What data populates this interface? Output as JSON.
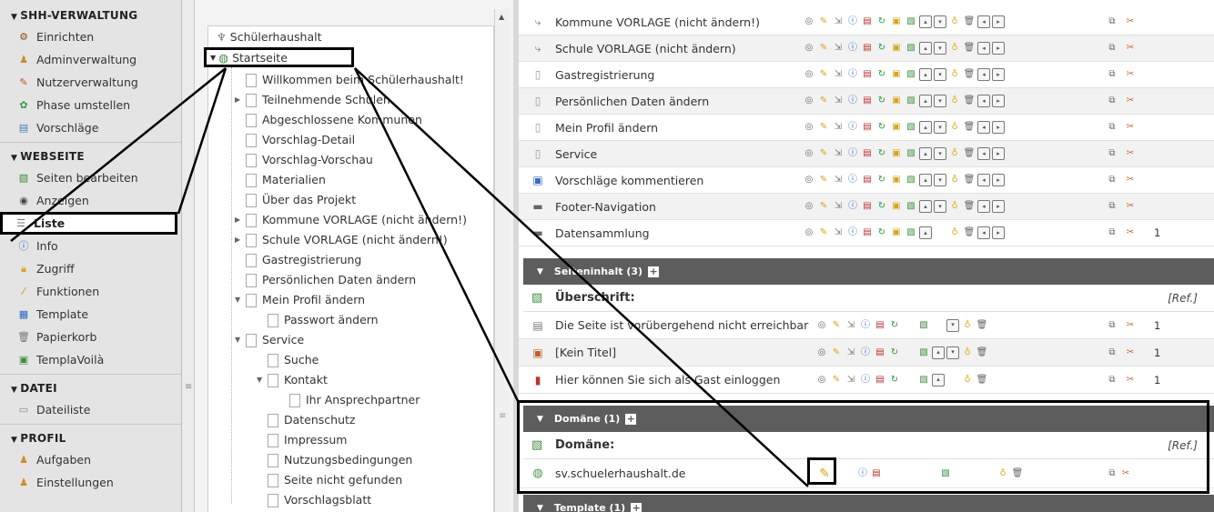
{
  "module_menu": {
    "sections": [
      {
        "title": "SHH-VERWALTUNG",
        "items": [
          {
            "label": "Einrichten",
            "icon": "gear-icon"
          },
          {
            "label": "Adminverwaltung",
            "icon": "users-icon"
          },
          {
            "label": "Nutzerverwaltung",
            "icon": "user-edit-icon"
          },
          {
            "label": "Phase umstellen",
            "icon": "phase-icon"
          },
          {
            "label": "Vorschläge",
            "icon": "document-icon"
          }
        ]
      },
      {
        "title": "WEBSEITE",
        "items": [
          {
            "label": "Seiten bearbeiten",
            "icon": "page-edit-icon"
          },
          {
            "label": "Anzeigen",
            "icon": "eye-icon"
          },
          {
            "label": "Liste",
            "icon": "list-icon",
            "active": true
          },
          {
            "label": "Info",
            "icon": "info-icon"
          },
          {
            "label": "Zugriff",
            "icon": "lock-icon"
          },
          {
            "label": "Funktionen",
            "icon": "wand-icon"
          },
          {
            "label": "Template",
            "icon": "template-icon"
          },
          {
            "label": "Papierkorb",
            "icon": "trash-icon"
          },
          {
            "label": "TemplaVoilà",
            "icon": "templavoila-icon"
          }
        ]
      },
      {
        "title": "DATEI",
        "items": [
          {
            "label": "Dateiliste",
            "icon": "folder-icon"
          }
        ]
      },
      {
        "title": "PROFIL",
        "items": [
          {
            "label": "Aufgaben",
            "icon": "tasks-icon"
          },
          {
            "label": "Einstellungen",
            "icon": "settings-user-icon"
          }
        ]
      }
    ]
  },
  "tree": {
    "root_label": "Schülerhaushalt",
    "start_label": "Startseite",
    "nodes": [
      {
        "label": "Willkommen beim Schülerhaushalt!",
        "indent": 1
      },
      {
        "label": "Teilnehmende Schulen",
        "indent": 1,
        "expandable": true
      },
      {
        "label": "Abgeschlossene Kommunen",
        "indent": 1
      },
      {
        "label": "Vorschlag-Detail",
        "indent": 1
      },
      {
        "label": "Vorschlag-Vorschau",
        "indent": 1
      },
      {
        "label": "Materialien",
        "indent": 1
      },
      {
        "label": "Über das Projekt",
        "indent": 1
      },
      {
        "label": "Kommune VORLAGE (nicht ändern!)",
        "indent": 1,
        "expandable": true
      },
      {
        "label": "Schule VORLAGE (nicht ändern!)",
        "indent": 1,
        "expandable": true
      },
      {
        "label": "Gastregistrierung",
        "indent": 1
      },
      {
        "label": "Persönlichen Daten ändern",
        "indent": 1
      },
      {
        "label": "Mein Profil ändern",
        "indent": 1,
        "expanded": true
      },
      {
        "label": "Passwort ändern",
        "indent": 2
      },
      {
        "label": "Service",
        "indent": 1,
        "expanded": true
      },
      {
        "label": "Suche",
        "indent": 2
      },
      {
        "label": "Kontakt",
        "indent": 2,
        "expanded": true
      },
      {
        "label": "Ihr Ansprechpartner",
        "indent": 3
      },
      {
        "label": "Datenschutz",
        "indent": 2
      },
      {
        "label": "Impressum",
        "indent": 2
      },
      {
        "label": "Nutzungsbedingungen",
        "indent": 2
      },
      {
        "label": "Seite nicht gefunden",
        "indent": 2
      },
      {
        "label": "Vorschlagsblatt",
        "indent": 2
      }
    ]
  },
  "list": {
    "pages": [
      {
        "title": "Kommune VORLAGE (nicht ändern!)",
        "count": ""
      },
      {
        "title": "Schule VORLAGE (nicht ändern)",
        "count": ""
      },
      {
        "title": "Gastregistrierung",
        "count": ""
      },
      {
        "title": "Persönlichen Daten ändern",
        "count": ""
      },
      {
        "title": "Mein Profil ändern",
        "count": ""
      },
      {
        "title": "Service",
        "count": ""
      },
      {
        "title": "Vorschläge kommentieren",
        "count": ""
      },
      {
        "title": "Footer-Navigation",
        "count": ""
      },
      {
        "title": "Datensammlung",
        "count": "1"
      }
    ],
    "content_section": {
      "label": "Seiteninhalt (3)",
      "header": "Überschrift:",
      "ref": "[Ref.]",
      "rows": [
        {
          "title": "Die Seite ist vorübergehend nicht erreichbar",
          "count": "1"
        },
        {
          "title": "[Kein Titel]",
          "count": "1"
        },
        {
          "title": "Hier können Sie sich als Gast einloggen",
          "count": "1"
        }
      ]
    },
    "domain_section": {
      "label": "Domäne (1)",
      "header": "Domäne:",
      "ref": "[Ref.]",
      "rows": [
        {
          "title": "sv.schuelerhaushalt.de"
        }
      ]
    },
    "template_section": {
      "label": "Template (1)"
    }
  },
  "colors": {
    "section_bar": "#5d5d5d",
    "highlight_border": "#000000"
  }
}
